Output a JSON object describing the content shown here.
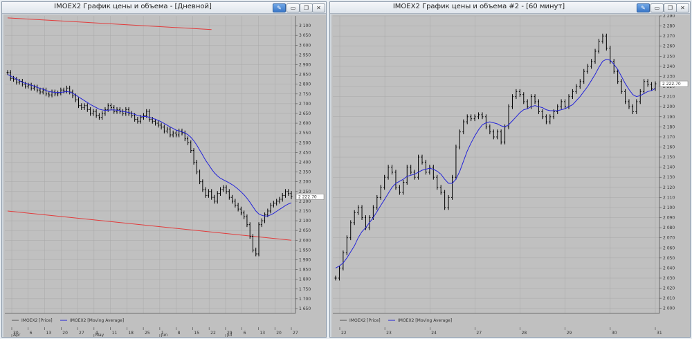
{
  "windows": [
    {
      "title": "IMOEX2 График цены и объема - [Дневной]",
      "buttons": [
        "pen-icon",
        "minimize-icon",
        "restore-icon",
        "close-icon"
      ]
    },
    {
      "title": "IMOEX2 График цены и объема #2 - [60 минут]",
      "buttons": [
        "pen-icon",
        "minimize-icon",
        "restore-icon",
        "close-icon"
      ]
    }
  ],
  "colors": {
    "price": "#000000",
    "ma": "#2323d8",
    "trend": "#e23b3b",
    "background": "#c0c0c0",
    "grid": "#a8a8a8"
  },
  "chart_data": [
    {
      "type": "line",
      "ylim": [
        1625,
        3150
      ],
      "yticks": [
        "3 100",
        "3 050",
        "3 000",
        "2 950",
        "2 900",
        "2 850",
        "2 800",
        "2 750",
        "2 700",
        "2 650",
        "2 600",
        "2 550",
        "2 500",
        "2 450",
        "2 400",
        "2 350",
        "2 300",
        "2 250",
        "2 200",
        "2 150",
        "2 100",
        "2 050",
        "2 000",
        "1 950",
        "1 900",
        "1 850",
        "1 800",
        "1 750",
        "1 700",
        "1 650"
      ],
      "yticks_values": [
        3100,
        3050,
        3000,
        2950,
        2900,
        2850,
        2800,
        2750,
        2700,
        2650,
        2600,
        2550,
        2500,
        2450,
        2400,
        2350,
        2300,
        2250,
        2200,
        2150,
        2100,
        2050,
        2000,
        1950,
        1900,
        1850,
        1800,
        1750,
        1700,
        1650
      ],
      "current_label": "2 222.70",
      "current_value": 2222.7,
      "xticks": [
        "30",
        "6",
        "13",
        "20",
        "27",
        "4",
        "11",
        "18",
        "25",
        "1",
        "8",
        "15",
        "22",
        "29",
        "6",
        "13",
        "20",
        "27"
      ],
      "months": [
        "Apr",
        "May",
        "Jun",
        "Jul"
      ],
      "legend": [
        "IMOEX2 [Price]",
        "IMOEX2 [Moving Average]"
      ],
      "series": [
        {
          "name": "IMOEX2 [Price]",
          "values": [
            2860,
            2830,
            2825,
            2810,
            2815,
            2800,
            2790,
            2795,
            2780,
            2785,
            2770,
            2760,
            2770,
            2750,
            2745,
            2760,
            2750,
            2755,
            2770,
            2765,
            2780,
            2760,
            2740,
            2720,
            2690,
            2680,
            2690,
            2670,
            2650,
            2660,
            2640,
            2630,
            2650,
            2670,
            2690,
            2680,
            2660,
            2670,
            2660,
            2650,
            2670,
            2650,
            2640,
            2620,
            2610,
            2630,
            2640,
            2660,
            2620,
            2610,
            2600,
            2590,
            2580,
            2560,
            2570,
            2540,
            2550,
            2540,
            2560,
            2550,
            2520,
            2500,
            2460,
            2400,
            2350,
            2300,
            2260,
            2230,
            2250,
            2220,
            2200,
            2240,
            2260,
            2270,
            2250,
            2220,
            2200,
            2180,
            2160,
            2140,
            2120,
            2080,
            2020,
            1950,
            1930,
            2080,
            2100,
            2130,
            2150,
            2180,
            2190,
            2200,
            2210,
            2230,
            2250,
            2240,
            2222.7
          ]
        },
        {
          "name": "IMOEX2 [Moving Average]",
          "values": [
            2850,
            2842,
            2835,
            2826,
            2818,
            2810,
            2805,
            2800,
            2795,
            2790,
            2784,
            2778,
            2774,
            2768,
            2762,
            2760,
            2758,
            2757,
            2758,
            2760,
            2762,
            2760,
            2754,
            2745,
            2735,
            2725,
            2716,
            2706,
            2696,
            2688,
            2680,
            2672,
            2668,
            2666,
            2667,
            2668,
            2668,
            2667,
            2664,
            2660,
            2658,
            2655,
            2651,
            2645,
            2640,
            2636,
            2634,
            2634,
            2630,
            2625,
            2620,
            2614,
            2607,
            2598,
            2590,
            2581,
            2573,
            2565,
            2560,
            2556,
            2550,
            2541,
            2528,
            2510,
            2488,
            2462,
            2436,
            2410,
            2388,
            2365,
            2345,
            2330,
            2318,
            2310,
            2302,
            2294,
            2285,
            2274,
            2262,
            2248,
            2233,
            2215,
            2195,
            2172,
            2150,
            2135,
            2128,
            2124,
            2124,
            2130,
            2138,
            2148,
            2158,
            2168,
            2178,
            2186,
            2192
          ]
        }
      ],
      "trendlines": [
        {
          "from": [
            0,
            3140
          ],
          "to": [
            69,
            3080
          ]
        },
        {
          "from": [
            0,
            2150
          ],
          "to": [
            96,
            2000
          ]
        }
      ]
    },
    {
      "type": "line",
      "ylim": [
        1995,
        2290
      ],
      "yticks": [
        "2 290",
        "2 280",
        "2 270",
        "2 260",
        "2 250",
        "2 240",
        "2 230",
        "2 220",
        "2 210",
        "2 200",
        "2 190",
        "2 180",
        "2 170",
        "2 160",
        "2 150",
        "2 140",
        "2 130",
        "2 120",
        "2 110",
        "2 100",
        "2 090",
        "2 080",
        "2 070",
        "2 060",
        "2 050",
        "2 040",
        "2 030",
        "2 020",
        "2 010",
        "2 000"
      ],
      "yticks_values": [
        2290,
        2280,
        2270,
        2260,
        2250,
        2240,
        2230,
        2220,
        2210,
        2200,
        2190,
        2180,
        2170,
        2160,
        2150,
        2140,
        2130,
        2120,
        2110,
        2100,
        2090,
        2080,
        2070,
        2060,
        2050,
        2040,
        2030,
        2020,
        2010,
        2000
      ],
      "current_label": "2 222.70",
      "current_value": 2222.7,
      "xticks": [
        "22",
        "23",
        "24",
        "27",
        "28",
        "29",
        "30",
        "31"
      ],
      "legend": [
        "IMOEX2 [Price]",
        "IMOEX2 [Moving Average]"
      ],
      "series": [
        {
          "name": "IMOEX2 [Price]",
          "values": [
            2030,
            2040,
            2055,
            2070,
            2085,
            2095,
            2100,
            2090,
            2080,
            2090,
            2100,
            2110,
            2120,
            2130,
            2140,
            2135,
            2120,
            2115,
            2125,
            2140,
            2135,
            2130,
            2150,
            2145,
            2135,
            2140,
            2130,
            2120,
            2115,
            2100,
            2110,
            2130,
            2160,
            2175,
            2185,
            2190,
            2188,
            2190,
            2192,
            2190,
            2180,
            2175,
            2170,
            2175,
            2165,
            2180,
            2200,
            2210,
            2215,
            2212,
            2205,
            2200,
            2210,
            2205,
            2195,
            2190,
            2185,
            2190,
            2195,
            2200,
            2205,
            2200,
            2210,
            2215,
            2220,
            2225,
            2235,
            2240,
            2245,
            2255,
            2265,
            2270,
            2258,
            2245,
            2235,
            2225,
            2215,
            2205,
            2200,
            2195,
            2205,
            2215,
            2225,
            2222,
            2218,
            2222.7
          ]
        },
        {
          "name": "IMOEX2 [Moving Average]",
          "values": [
            2040,
            2042,
            2045,
            2050,
            2056,
            2062,
            2070,
            2076,
            2080,
            2085,
            2090,
            2096,
            2102,
            2108,
            2114,
            2120,
            2124,
            2126,
            2128,
            2131,
            2132,
            2133,
            2135,
            2137,
            2138,
            2139,
            2138,
            2136,
            2133,
            2128,
            2124,
            2124,
            2128,
            2136,
            2146,
            2156,
            2164,
            2171,
            2177,
            2182,
            2184,
            2185,
            2184,
            2183,
            2181,
            2180,
            2182,
            2186,
            2190,
            2194,
            2197,
            2198,
            2200,
            2201,
            2200,
            2199,
            2197,
            2196,
            2196,
            2196,
            2197,
            2198,
            2200,
            2202,
            2206,
            2210,
            2215,
            2220,
            2226,
            2232,
            2239,
            2245,
            2247,
            2246,
            2242,
            2237,
            2230,
            2223,
            2217,
            2212,
            2210,
            2211,
            2213,
            2215,
            2216,
            2218
          ]
        }
      ]
    }
  ]
}
